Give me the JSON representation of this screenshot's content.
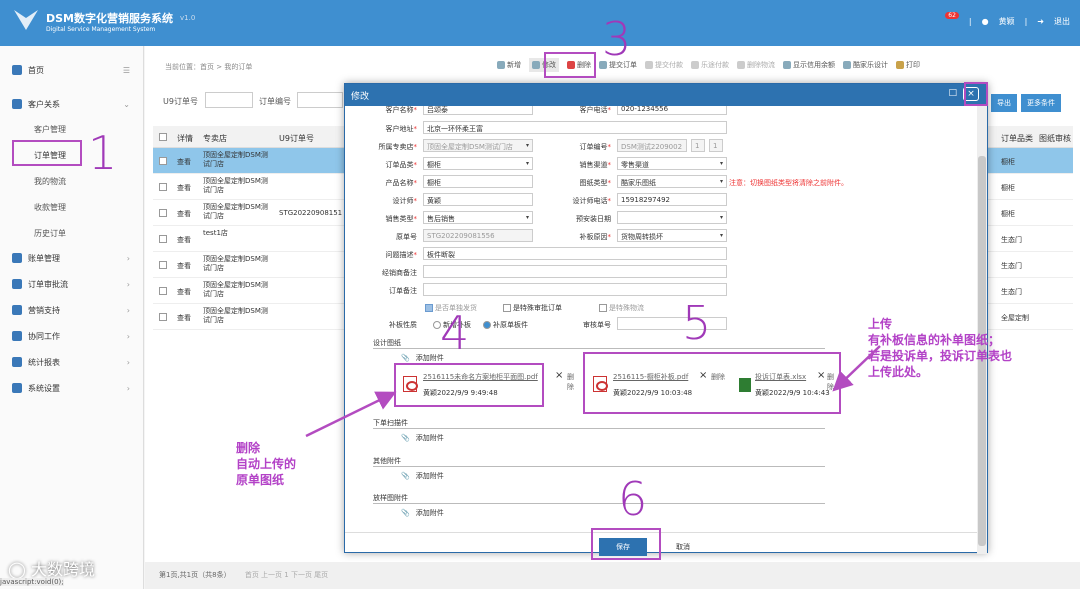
{
  "app": {
    "title": "DSM数字化营销服务系统",
    "subtitle": "Digital Service Management System",
    "version": "v1.0",
    "notif_count": "62",
    "user": "黄颖",
    "logout": "退出"
  },
  "sidebar": {
    "home": "首页",
    "customer": "客户关系",
    "sub": [
      "客户管理",
      "订单管理",
      "我的物流",
      "收款管理",
      "历史订单"
    ],
    "items": [
      "账单管理",
      "订单审批流",
      "营销支持",
      "协同工作",
      "统计报表",
      "系统设置"
    ]
  },
  "breadcrumb": "当前位置：首页 > 我的订单",
  "toolbar": [
    "新增",
    "修改",
    "删除",
    "提交订单",
    "提交付款",
    "乐途付款",
    "删除物流",
    "显示信用余额",
    "酷家乐设计",
    "打印"
  ],
  "filter": {
    "u9_label": "U9订单号",
    "order_label": "订单编号"
  },
  "grid": {
    "headers": [
      "详情",
      "专卖店",
      "U9订单号"
    ],
    "right_headers": [
      "订单品类",
      "图纸审核"
    ],
    "rows": [
      {
        "detail": "查看",
        "store": "顶固全屋定制DSM测试门店",
        "u9": "",
        "cat": "橱柜"
      },
      {
        "detail": "查看",
        "store": "顶固全屋定制DSM测试门店",
        "u9": "",
        "cat": "橱柜"
      },
      {
        "detail": "查看",
        "store": "顶固全屋定制DSM测试门店",
        "u9": "STG20220908151",
        "cat": "橱柜"
      },
      {
        "detail": "查看",
        "store": "test1店",
        "u9": "",
        "cat": "生态门"
      },
      {
        "detail": "查看",
        "store": "顶固全屋定制DSM测试门店",
        "u9": "",
        "cat": "生态门"
      },
      {
        "detail": "查看",
        "store": "顶固全屋定制DSM测试门店",
        "u9": "",
        "cat": "生态门"
      },
      {
        "detail": "查看",
        "store": "顶固全屋定制DSM测试门店",
        "u9": "",
        "cat": "全屋定制"
      }
    ]
  },
  "right_buttons": {
    "export": "导出",
    "more": "更多条件"
  },
  "footer": {
    "pager": "第1页,共1页（共8条）",
    "nav": "首页 上一页 1 下一页 尾页"
  },
  "modal": {
    "title": "修改",
    "fields": {
      "customer_name_label": "客户名称",
      "customer_name": "吕颂泰",
      "customer_phone_label": "客户电话",
      "customer_phone": "020-1234556",
      "customer_addr_label": "客户地址",
      "customer_addr": "北京一环怀柔王富",
      "store_label": "所属专卖店",
      "store": "顶固全屋定制DSM测试门店",
      "order_no_label": "订单编号",
      "order_no": "DSM测试2209002",
      "order_no_a": "1",
      "order_no_b": "1",
      "category_label": "订单品类",
      "category": "橱柜",
      "channel_label": "销售渠道",
      "channel": "零售渠道",
      "product_label": "产品名称",
      "product": "橱柜",
      "drawing_type_label": "图纸类型",
      "drawing_type": "酷家乐图纸",
      "note": "注意：切换图纸类型将清除之前附件。",
      "designer_label": "设计师",
      "designer": "黄颖",
      "designer_phone_label": "设计师电话",
      "designer_phone": "15918297492",
      "sales_type_label": "销售类型",
      "sales_type": "售后销售",
      "install_date_label": "预安装日期",
      "install_date": "",
      "original_no_label": "原单号",
      "original_no": "STG202209081556",
      "replace_reason_label": "补板原因",
      "replace_reason": "货物周转损坏",
      "issue_label": "问题描述",
      "issue": "板件断裂",
      "dealer_note_label": "经销商备注",
      "dealer_note": "",
      "order_note_label": "订单备注",
      "order_note": "",
      "chk_samples": "是否单独发货",
      "chk_special": "是特殊审批订单",
      "chk_logistics": "是特殊物流",
      "board_nature_label": "补板性质",
      "radio_new": "新增补板",
      "radio_orig": "补原单板件",
      "audit_no_label": "审核单号"
    },
    "sections": {
      "design": "设计图纸",
      "scan": "下单扫描件",
      "other": "其他附件",
      "sample": "放样图附件"
    },
    "add_attachment": "添加附件",
    "delete": "删除",
    "attachments": [
      {
        "name": "2516115未命名方案地柜平面图.pdf",
        "meta": "黄颖2022/9/9 9:49:48"
      },
      {
        "name": "2516115-橱柜补板.pdf",
        "meta": "黄颖2022/9/9 10:03:48"
      },
      {
        "name": "投诉订单表.xlsx",
        "meta": "黄颖2022/9/9 10:4:43"
      }
    ],
    "save": "保存",
    "cancel": "取消"
  },
  "annotations": {
    "n1": "1",
    "n3": "3",
    "n4": "4",
    "n5": "5",
    "n6": "6",
    "left_text": [
      "删除",
      "自动上传的",
      "原单图纸"
    ],
    "right_text": [
      "上传",
      "有补板信息的补单图纸；",
      "若是投诉单，投诉订单表也",
      "上传此处。"
    ]
  },
  "watermark": "大数跨境",
  "status_url": "javascript:void(0);"
}
